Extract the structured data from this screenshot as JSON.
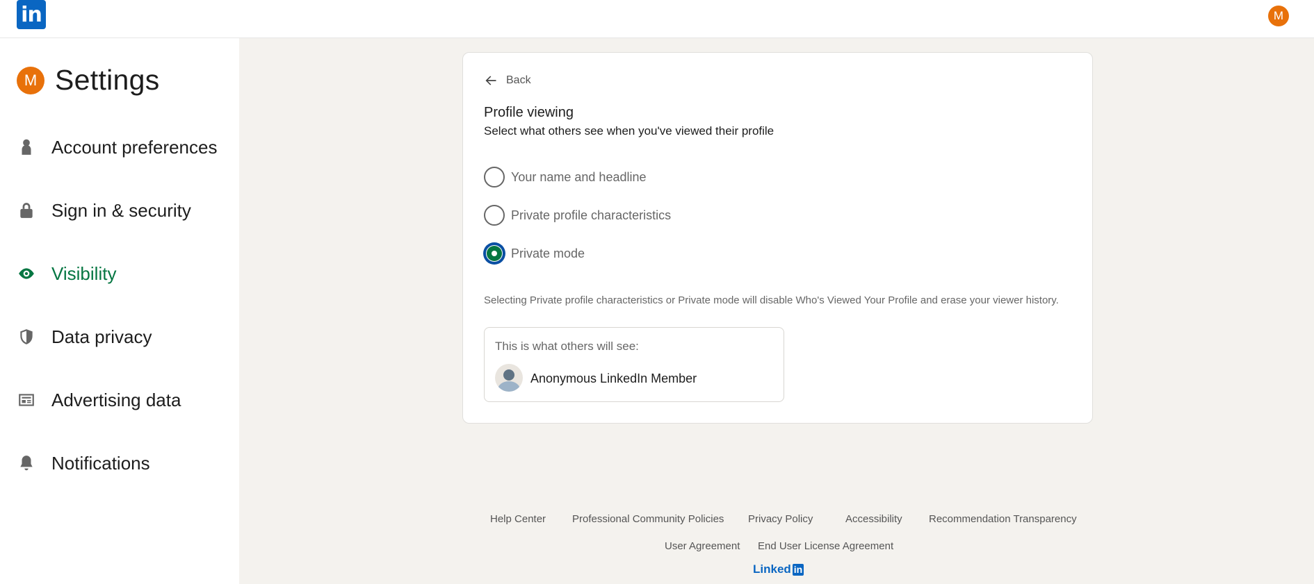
{
  "topbar": {
    "logo_text": "in",
    "avatar_initial": "M"
  },
  "sidebar": {
    "avatar_initial": "M",
    "title": "Settings",
    "items": [
      {
        "label": "Account preferences",
        "icon": "person-icon",
        "active": false
      },
      {
        "label": "Sign in & security",
        "icon": "lock-icon",
        "active": false
      },
      {
        "label": "Visibility",
        "icon": "eye-icon",
        "active": true
      },
      {
        "label": "Data privacy",
        "icon": "shield-icon",
        "active": false
      },
      {
        "label": "Advertising data",
        "icon": "newspaper-icon",
        "active": false
      },
      {
        "label": "Notifications",
        "icon": "bell-icon",
        "active": false
      }
    ]
  },
  "card": {
    "back_label": "Back",
    "title": "Profile viewing",
    "subtitle": "Select what others see when you've viewed their profile",
    "options": [
      {
        "label": "Your name and headline",
        "checked": false
      },
      {
        "label": "Private profile characteristics",
        "checked": false
      },
      {
        "label": "Private mode",
        "checked": true
      }
    ],
    "note": "Selecting Private profile characteristics or Private mode will disable Who's Viewed Your Profile and erase your viewer history.",
    "preview": {
      "title": "This is what others will see:",
      "name": "Anonymous LinkedIn Member"
    }
  },
  "footer": {
    "row1": [
      "Help Center",
      "Professional Community Policies",
      "Privacy Policy",
      "Accessibility",
      "Recommendation Transparency"
    ],
    "row2": [
      "User Agreement",
      "End User License Agreement"
    ],
    "brand_text": "Linked",
    "brand_box": "in"
  },
  "colors": {
    "brand_blue": "#0a66c2",
    "active_green": "#057642",
    "avatar_orange": "#e8710a",
    "page_bg": "#f4f2ee"
  }
}
